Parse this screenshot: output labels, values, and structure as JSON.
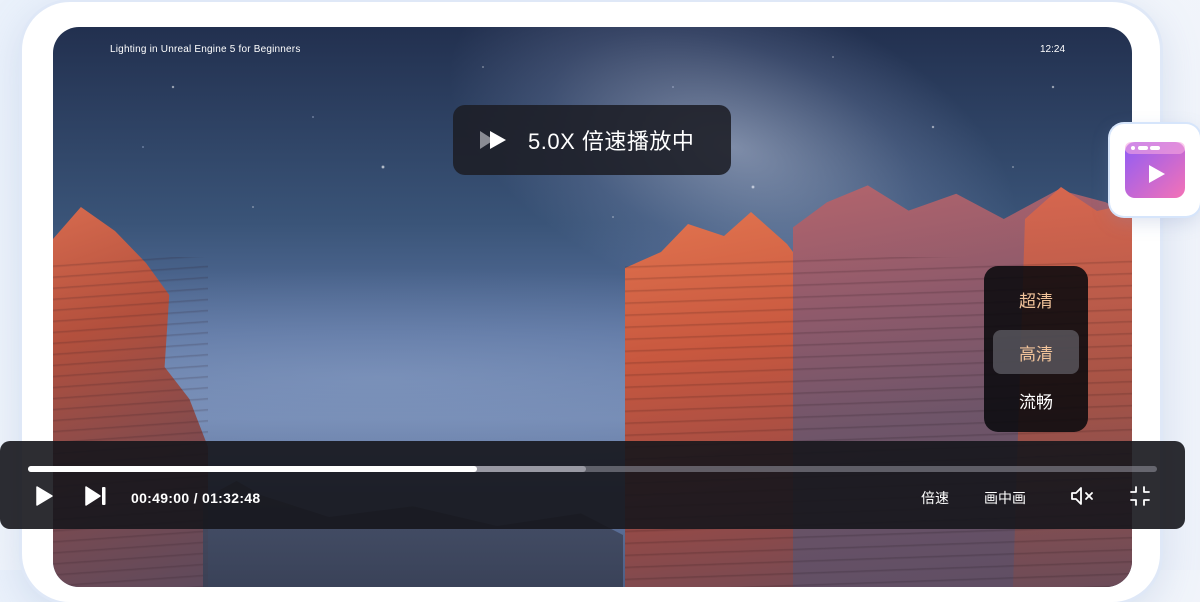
{
  "video": {
    "title": "Lighting in Unreal Engine 5 for Beginners",
    "clock": "12:24"
  },
  "speed_toast": {
    "icon": "fast-forward-icon",
    "text": "5.0X 倍速播放中"
  },
  "quality_menu": {
    "options": [
      "超清",
      "高清",
      "流畅"
    ],
    "selected": "高清"
  },
  "controls": {
    "time": "00:49:00 / 01:32:48",
    "progress": 0.398,
    "buffered": 0.494,
    "speed_label": "倍速",
    "pip_label": "画中画",
    "icons": {
      "play": "play-icon",
      "next": "skip-next-icon",
      "mute": "volume-mute-icon",
      "exit_fullscreen": "exit-fullscreen-icon"
    }
  },
  "app_icon": {
    "name": "video-player-app-icon",
    "colors": [
      "#8f5cf6",
      "#f472b6"
    ]
  }
}
